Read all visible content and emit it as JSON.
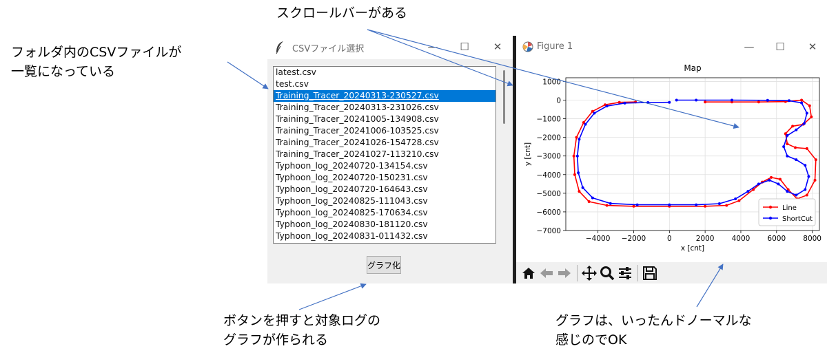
{
  "annotations": {
    "scrollbar": "スクロールバーがある",
    "folder_line1": "フォルダ内のCSVファイルが",
    "folder_line2": "一覧になっている",
    "button_line1": "ボタンを押すと対象ログの",
    "button_line2": "グラフが作られる",
    "graph_line1": "グラフは、いったんドノーマルな",
    "graph_line2": "感じのでOK"
  },
  "csv_window": {
    "title": "CSVファイル選択",
    "files": [
      "latest.csv",
      "test.csv",
      "Training_Tracer_20240313-230527.csv",
      "Training_Tracer_20240313-231026.csv",
      "Training_Tracer_20241005-134908.csv",
      "Training_Tracer_20241006-103525.csv",
      "Training_Tracer_20241026-154728.csv",
      "Training_Tracer_20241027-113210.csv",
      "Typhoon_log_20240720-134154.csv",
      "Typhoon_log_20240720-150231.csv",
      "Typhoon_log_20240720-164643.csv",
      "Typhoon_log_20240825-111043.csv",
      "Typhoon_log_20240825-170634.csv",
      "Typhoon_log_20240830-181120.csv",
      "Typhoon_log_20240831-011432.csv"
    ],
    "selected_index": 2,
    "button_label": "グラフ化"
  },
  "figure_window": {
    "title": "Figure 1",
    "toolbar_icons": [
      "home-icon",
      "back-icon",
      "forward-icon",
      "pan-icon",
      "zoom-icon",
      "configure-icon",
      "save-icon"
    ]
  },
  "chart_data": {
    "type": "line",
    "title": "Map",
    "xlabel": "x [cnt]",
    "ylabel": "y [cnt]",
    "xlim": [
      -5800,
      8400
    ],
    "ylim": [
      -7000,
      1200
    ],
    "xticks": [
      "−4000",
      "−2000",
      "0",
      "2000",
      "4000",
      "6000",
      "8000"
    ],
    "yticks": [
      "1000",
      "0",
      "−1000",
      "−2000",
      "−3000",
      "−4000",
      "−5000",
      "−6000",
      "−7000"
    ],
    "grid": true,
    "legend_position": "lower-right",
    "series": [
      {
        "name": "Line",
        "color": "#ff0000",
        "points": [
          [
            -1900,
            -100
          ],
          [
            -2800,
            -120
          ],
          [
            -3600,
            -250
          ],
          [
            -4300,
            -600
          ],
          [
            -4800,
            -1200
          ],
          [
            -5200,
            -2000
          ],
          [
            -5350,
            -3000
          ],
          [
            -5300,
            -4000
          ],
          [
            -5050,
            -4900
          ],
          [
            -4500,
            -5450
          ],
          [
            -3500,
            -5650
          ],
          [
            -2000,
            -5700
          ],
          [
            0,
            -5700
          ],
          [
            2000,
            -5700
          ],
          [
            3200,
            -5650
          ],
          [
            3900,
            -5400
          ],
          [
            4700,
            -4800
          ],
          [
            5200,
            -4400
          ],
          [
            5700,
            -4150
          ],
          [
            6200,
            -4250
          ],
          [
            6650,
            -4800
          ],
          [
            7150,
            -5300
          ],
          [
            7700,
            -5100
          ],
          [
            8150,
            -4300
          ],
          [
            8200,
            -3200
          ],
          [
            7700,
            -2600
          ],
          [
            7050,
            -2550
          ],
          [
            6600,
            -2350
          ],
          [
            6500,
            -1800
          ],
          [
            6900,
            -1400
          ],
          [
            7500,
            -1300
          ],
          [
            7950,
            -900
          ],
          [
            7850,
            -300
          ],
          [
            7400,
            0
          ],
          [
            6500,
            -80
          ],
          [
            5000,
            -100
          ],
          [
            3500,
            -100
          ],
          [
            2000,
            -100
          ]
        ]
      },
      {
        "name": "ShortCut",
        "color": "#0000ff",
        "points": [
          [
            0,
            -120
          ],
          [
            -1200,
            -130
          ],
          [
            -2500,
            -160
          ],
          [
            -3500,
            -320
          ],
          [
            -4200,
            -700
          ],
          [
            -4700,
            -1300
          ],
          [
            -5050,
            -2100
          ],
          [
            -5150,
            -3000
          ],
          [
            -5100,
            -3900
          ],
          [
            -4850,
            -4700
          ],
          [
            -4300,
            -5250
          ],
          [
            -3300,
            -5550
          ],
          [
            -1800,
            -5620
          ],
          [
            0,
            -5620
          ],
          [
            1500,
            -5620
          ],
          [
            2800,
            -5560
          ],
          [
            3700,
            -5300
          ],
          [
            4400,
            -4900
          ],
          [
            5000,
            -4500
          ],
          [
            5600,
            -4300
          ],
          [
            6100,
            -4500
          ],
          [
            6600,
            -4900
          ],
          [
            7100,
            -5100
          ],
          [
            7600,
            -4800
          ],
          [
            7800,
            -4100
          ],
          [
            7600,
            -3500
          ],
          [
            7100,
            -3200
          ],
          [
            6600,
            -3000
          ],
          [
            6400,
            -2500
          ],
          [
            6600,
            -1900
          ],
          [
            7100,
            -1600
          ],
          [
            7550,
            -1250
          ],
          [
            7700,
            -700
          ],
          [
            7400,
            -150
          ],
          [
            6700,
            -30
          ],
          [
            5500,
            -10
          ],
          [
            3500,
            0
          ],
          [
            1500,
            0
          ],
          [
            400,
            0
          ]
        ]
      }
    ]
  }
}
